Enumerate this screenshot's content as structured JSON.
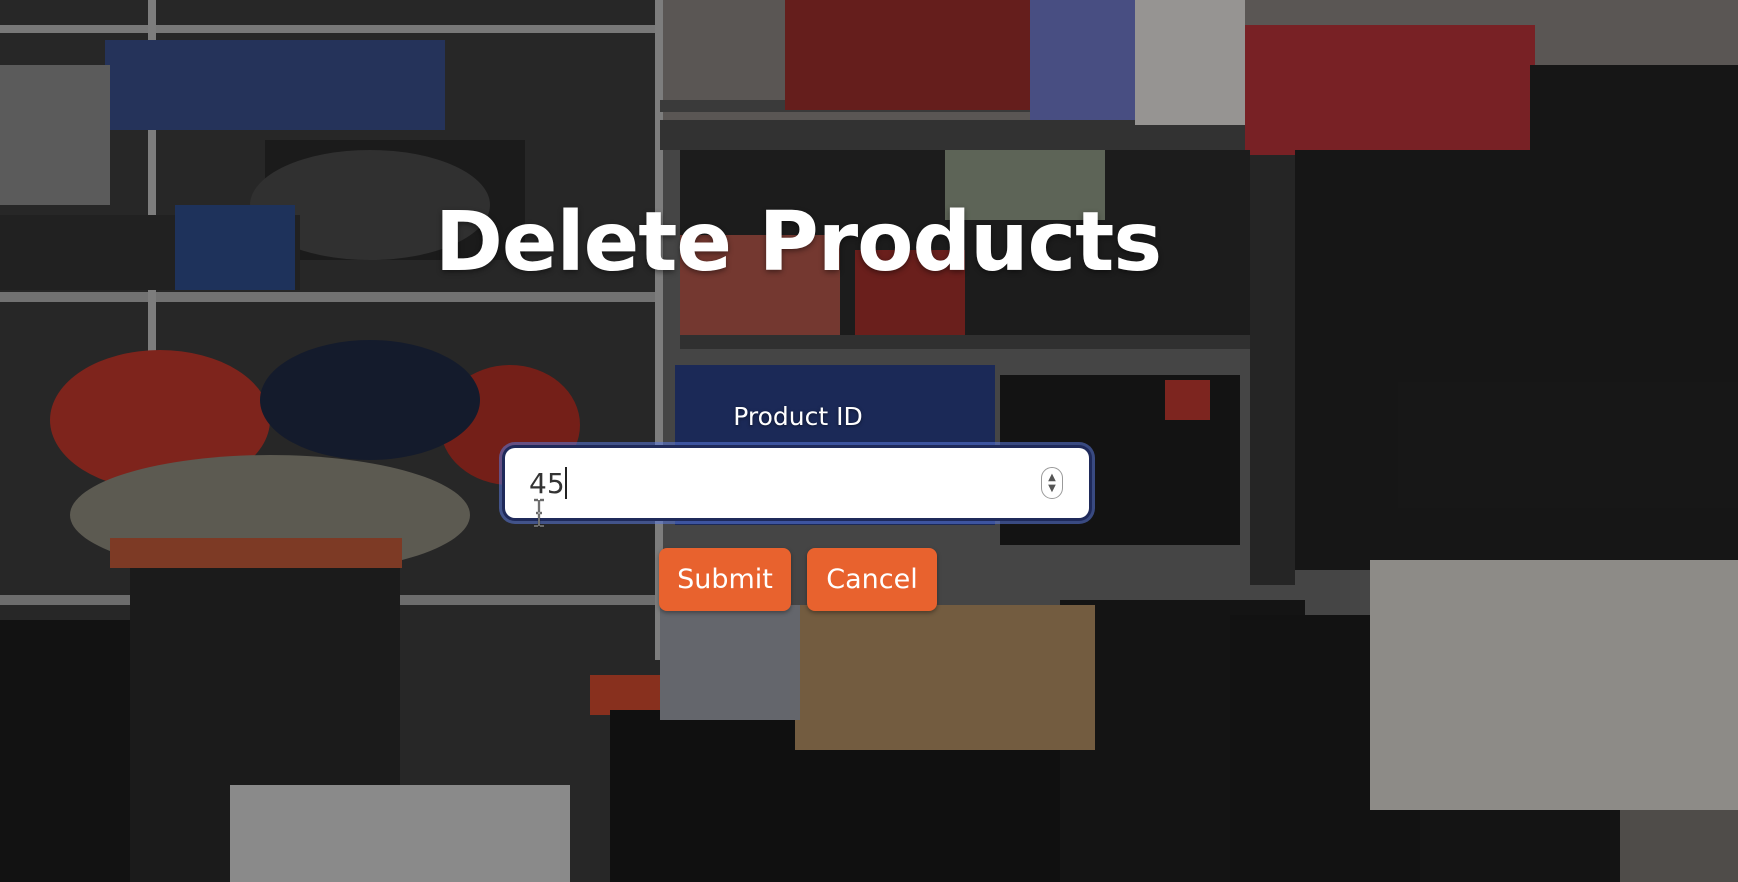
{
  "page": {
    "title": "Delete Products"
  },
  "form": {
    "product_id_label": "Product ID",
    "product_id_value": "45",
    "submit_label": "Submit",
    "cancel_label": "Cancel"
  },
  "colors": {
    "button_bg": "#e8622e",
    "button_text": "#ffffff",
    "input_focus_ring": "#1f2a5a",
    "title_text": "#ffffff"
  },
  "icons": {
    "spinner": "number-spinner-icon",
    "cursor": "text-cursor-icon"
  }
}
